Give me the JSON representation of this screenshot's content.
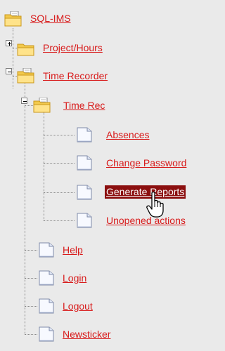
{
  "tree": {
    "root": {
      "label": "SQL-IMS"
    },
    "project_hours": {
      "label": "Project/Hours",
      "expander": "plus"
    },
    "time_recorder": {
      "label": "Time Recorder",
      "expander": "minus"
    },
    "time_rec": {
      "label": "Time Rec",
      "expander": "minus"
    },
    "time_rec_children": [
      {
        "label": "Absences"
      },
      {
        "label": "Change Password"
      },
      {
        "label": "Generate Reports",
        "selected": true
      },
      {
        "label": "Unopened actions"
      }
    ],
    "time_recorder_children": [
      {
        "label": "Help"
      },
      {
        "label": "Login"
      },
      {
        "label": "Logout"
      },
      {
        "label": "Newsticker"
      }
    ]
  },
  "colors": {
    "link": "#d81a1a",
    "selected_background": "#8b0f0f",
    "background": "#eaeaea"
  },
  "cursor": "hand-pointer"
}
